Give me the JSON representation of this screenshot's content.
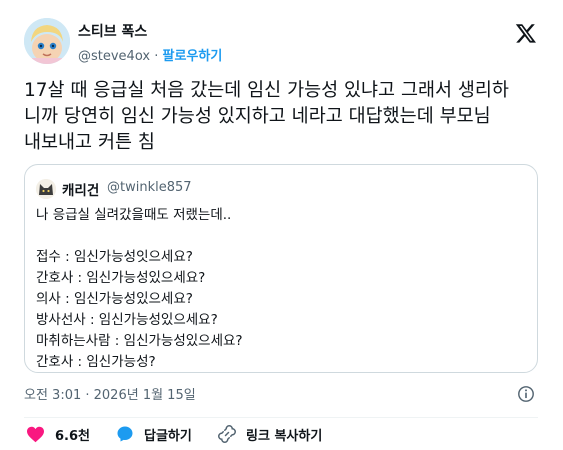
{
  "author": {
    "display_name": "스티브 폭스",
    "handle": "@steve4ox",
    "separator": "·",
    "follow_label": "팔로우하기"
  },
  "tweet": {
    "lines": [
      "17살 때 응급실 처음 갔는데 임신 가능성 있냐고 그래서 생리하",
      "니까 당연히 임신 가능성 있지하고 네라고 대답했는데 부모님",
      "내보내고 커튼 침"
    ]
  },
  "quote": {
    "display_name": "캐리건",
    "handle": "@twinkle857",
    "lines": [
      "나 응급실 실려갔을때도 저랬는데..",
      "",
      "접수 : 임신가능성잇으세요?",
      "간호사 : 임신가능성있으세요?",
      "의사 : 임신가능성있으세요?",
      "방사선사 : 임신가능성있으세요?",
      "마취하는사람 : 임신가능성있으세요?",
      "간호사 : 임신가능성?"
    ]
  },
  "meta": {
    "timestamp": "오전 3:01 · 2026년 1월 15일"
  },
  "actions": {
    "likes": "6.6천",
    "reply_label": "답글하기",
    "copy_link_label": "링크 복사하기"
  },
  "colors": {
    "accent": "#1d9bf0",
    "like": "#f91880",
    "text": "#0f1419",
    "muted": "#536471"
  },
  "icons": [
    "x-logo-icon",
    "info-icon",
    "heart-icon",
    "reply-bubble-icon",
    "link-icon"
  ]
}
